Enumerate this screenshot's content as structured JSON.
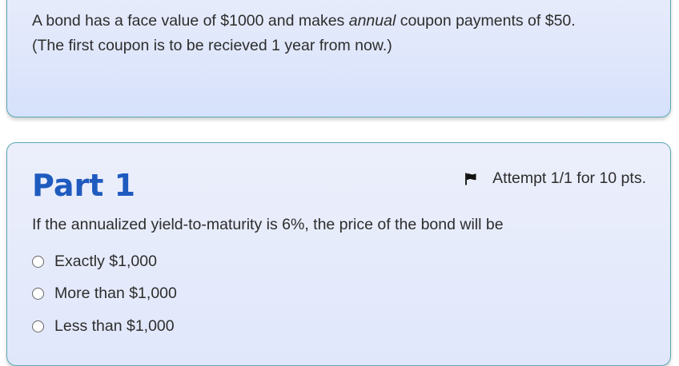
{
  "intro": {
    "line1_before": "A bond has a face value of $1000 and makes ",
    "line1_emphasis": "annual",
    "line1_after": " coupon payments of $50.",
    "line2": "(The first coupon is to be recieved 1 year from now.)"
  },
  "part": {
    "title": "Part 1",
    "attempt": "Attempt 1/1 for 10 pts.",
    "question": "If the annualized yield-to-maturity is 6%, the price of the bond will be",
    "options": [
      {
        "label": "Exactly $1,000",
        "selected": false
      },
      {
        "label": "More than $1,000",
        "selected": false
      },
      {
        "label": "Less than $1,000",
        "selected": false
      }
    ]
  },
  "icons": {
    "flag": "flag-icon",
    "radio": "radio-icon"
  }
}
